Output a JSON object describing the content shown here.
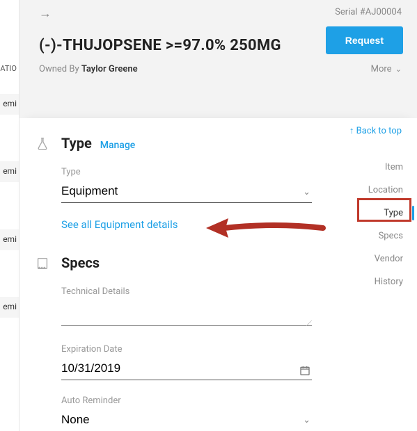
{
  "header": {
    "serial_label": "Serial #AJ00004",
    "title": "(-)-THUJOPSENE  >=97.0% 250MG",
    "owned_prefix": "Owned By",
    "owner": "Taylor Greene",
    "request_label": "Request",
    "more_label": "More"
  },
  "left": {
    "top_label": "ATIO",
    "rows": [
      "emi",
      "emi",
      "emi",
      "emi"
    ]
  },
  "content": {
    "back_to_top": "Back to top",
    "sidenav": {
      "items": [
        {
          "label": "Item",
          "name": "sidenav-item",
          "active": false
        },
        {
          "label": "Location",
          "name": "sidenav-location",
          "active": false
        },
        {
          "label": "Type",
          "name": "sidenav-type",
          "active": true
        },
        {
          "label": "Specs",
          "name": "sidenav-specs",
          "active": false
        },
        {
          "label": "Vendor",
          "name": "sidenav-vendor",
          "active": false
        },
        {
          "label": "History",
          "name": "sidenav-history",
          "active": false
        }
      ]
    },
    "type_section": {
      "title": "Type",
      "manage_label": "Manage",
      "type_label": "Type",
      "type_value": "Equipment",
      "see_all_link": "See all Equipment details"
    },
    "specs_section": {
      "title": "Specs",
      "tech_label": "Technical Details",
      "tech_value": "",
      "exp_label": "Expiration Date",
      "exp_value": "10/31/2019",
      "auto_label": "Auto Reminder",
      "auto_value": "None"
    }
  }
}
